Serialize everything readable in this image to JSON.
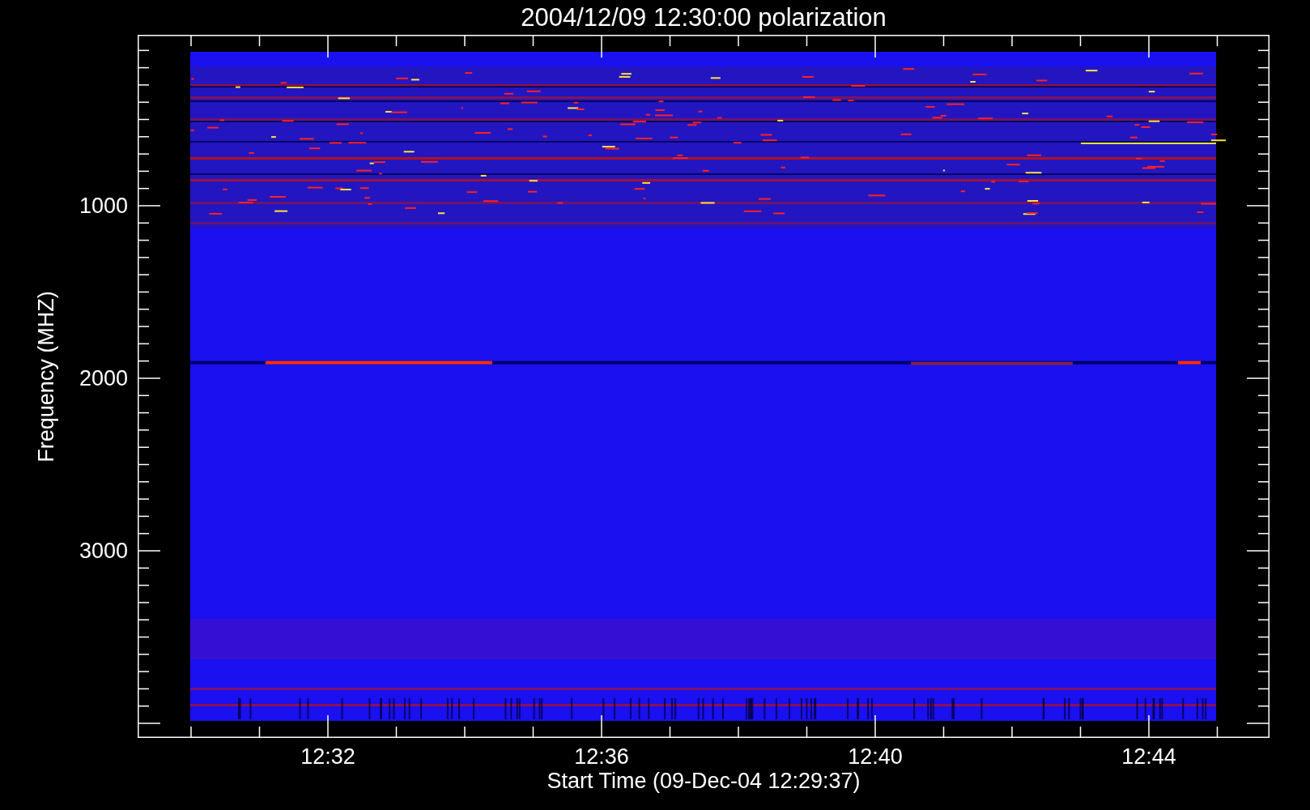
{
  "title": "2004/12/09 12:30:00 polarization",
  "y_axis": {
    "label": "Frequency (MHZ)",
    "tick_labels": [
      "1000",
      "2000",
      "3000"
    ]
  },
  "x_axis": {
    "label": "Start Time (09-Dec-04 12:29:37)",
    "tick_labels": [
      "12:32",
      "12:36",
      "12:40",
      "12:44"
    ]
  }
}
